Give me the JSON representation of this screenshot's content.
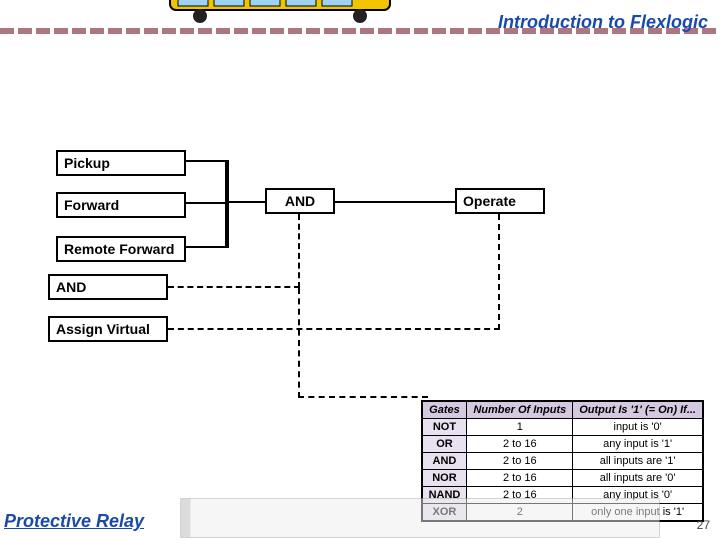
{
  "title": "Introduction to Flexlogic",
  "footer_title": "Protective Relay",
  "page_number": "27",
  "blocks": {
    "pickup": "Pickup",
    "forward": "Forward",
    "remote_fwd": "Remote Forward",
    "and_block": "AND",
    "assign_virtual": "Assign Virtual",
    "and_gate": "AND",
    "operate": "Operate"
  },
  "gates_table": {
    "headers": [
      "Gates",
      "Number Of Inputs",
      "Output Is '1' (= On) If..."
    ],
    "rows": [
      [
        "NOT",
        "1",
        "input is '0'"
      ],
      [
        "OR",
        "2 to 16",
        "any input is '1'"
      ],
      [
        "AND",
        "2 to 16",
        "all inputs are '1'"
      ],
      [
        "NOR",
        "2 to 16",
        "all inputs are '0'"
      ],
      [
        "NAND",
        "2 to 16",
        "any input is '0'"
      ],
      [
        "XOR",
        "2",
        "only one input is '1'"
      ]
    ]
  }
}
